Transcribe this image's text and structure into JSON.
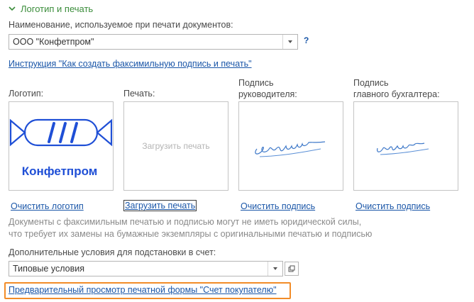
{
  "section": {
    "title": "Логотип и печать"
  },
  "name_field": {
    "label": "Наименование, используемое при печати документов:",
    "value": "ООО \"Конфетпром\"",
    "help": "?"
  },
  "instruction_link": "Инструкция \"Как создать факсимильную подпись и печать\"",
  "images": {
    "logo": {
      "label": "Логотип:",
      "logo_text": "Конфетпром",
      "action": "Очистить логотип"
    },
    "stamp": {
      "label": "Печать:",
      "placeholder": "Загрузить печать",
      "action": "Загрузить печать"
    },
    "director": {
      "label_line1": "Подпись",
      "label_line2": "руководителя:",
      "action": "Очистить подпись"
    },
    "accountant": {
      "label_line1": "Подпись",
      "label_line2": "главного бухгалтера:",
      "action": "Очистить подпись"
    }
  },
  "note": {
    "line1": "Документы с факсимильным печатью и подписью могут не иметь юридической силы,",
    "line2": "что требует их замены на бумажные экземпляры с оригинальными печатью и подписью"
  },
  "conditions_field": {
    "label": "Дополнительные условия для подстановки в счет:",
    "value": "Типовые условия"
  },
  "preview_link": "Предварительный просмотр печатной формы \"Счет покупателю\"",
  "colors": {
    "section_green": "#3b8d3b",
    "link_blue": "#1a56a8",
    "highlight_orange": "#f28c28",
    "logo_blue": "#1f4fd6"
  }
}
